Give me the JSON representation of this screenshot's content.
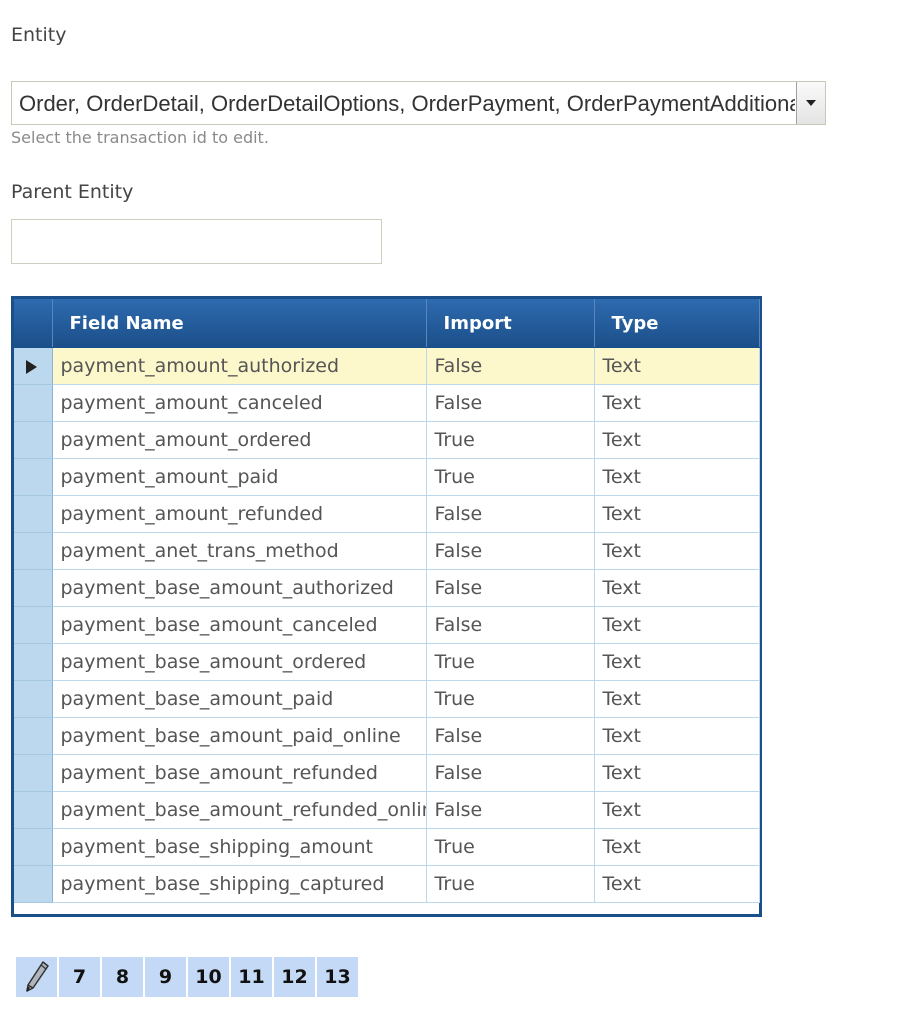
{
  "entity": {
    "label": "Entity",
    "value": "Order, OrderDetail, OrderDetailOptions, OrderPayment, OrderPaymentAdditional",
    "hint": "Select the transaction id to edit."
  },
  "parent_entity": {
    "label": "Parent Entity",
    "value": ""
  },
  "grid": {
    "columns": [
      "Field Name",
      "Import",
      "Type"
    ],
    "rows": [
      {
        "field": "payment_amount_authorized",
        "import": "False",
        "type": "Text",
        "active": true
      },
      {
        "field": "payment_amount_canceled",
        "import": "False",
        "type": "Text"
      },
      {
        "field": "payment_amount_ordered",
        "import": "True",
        "type": "Text"
      },
      {
        "field": "payment_amount_paid",
        "import": "True",
        "type": "Text"
      },
      {
        "field": "payment_amount_refunded",
        "import": "False",
        "type": "Text"
      },
      {
        "field": "payment_anet_trans_method",
        "import": "False",
        "type": "Text"
      },
      {
        "field": "payment_base_amount_authorized",
        "import": "False",
        "type": "Text"
      },
      {
        "field": "payment_base_amount_canceled",
        "import": "False",
        "type": "Text"
      },
      {
        "field": "payment_base_amount_ordered",
        "import": "True",
        "type": "Text"
      },
      {
        "field": "payment_base_amount_paid",
        "import": "True",
        "type": "Text"
      },
      {
        "field": "payment_base_amount_paid_online",
        "import": "False",
        "type": "Text"
      },
      {
        "field": "payment_base_amount_refunded",
        "import": "False",
        "type": "Text"
      },
      {
        "field": "payment_base_amount_refunded_online",
        "import": "False",
        "type": "Text"
      },
      {
        "field": "payment_base_shipping_amount",
        "import": "True",
        "type": "Text"
      },
      {
        "field": "payment_base_shipping_captured",
        "import": "True",
        "type": "Text"
      }
    ]
  },
  "pager": {
    "icon": "pencil-icon",
    "pages": [
      "7",
      "8",
      "9",
      "10",
      "11",
      "12",
      "13"
    ]
  }
}
